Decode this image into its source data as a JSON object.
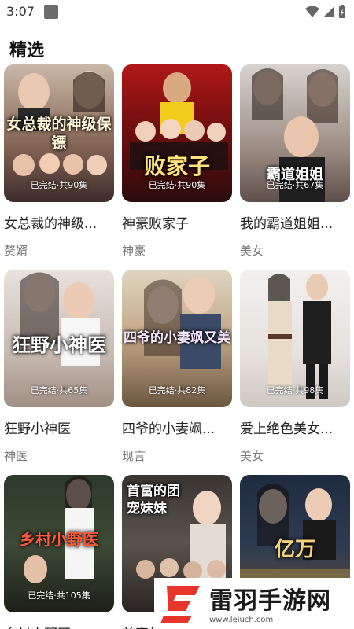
{
  "status_bar": {
    "time": "3:07"
  },
  "section": {
    "title": "精选"
  },
  "cards": [
    {
      "cover_text": "女总裁的神级保镖",
      "status": "已完结·共90集",
      "title": "女总裁的神级...",
      "tag": "赘婿"
    },
    {
      "cover_text": "败家子",
      "status": "已完结·共90集",
      "title": "神豪败家子",
      "tag": "神豪"
    },
    {
      "cover_text": "霸道姐姐",
      "status": "已完结·共67集",
      "title": "我的霸道姐姐...",
      "tag": "美女"
    },
    {
      "cover_text": "狂野小神医",
      "status": "已完结·共65集",
      "title": "狂野小神医",
      "tag": "神医"
    },
    {
      "cover_text": "四爷的小妻飒又美",
      "status": "已完结·共82集",
      "title": "四爷的小妻飒...",
      "tag": "现言"
    },
    {
      "cover_text": "",
      "status": "已完结·共98集",
      "title": "爱上绝色美女...",
      "tag": "美女"
    },
    {
      "cover_text": "乡村小野医",
      "status": "已完结·共105集",
      "title": "乡村小野医",
      "tag": ""
    },
    {
      "cover_text": "首富的团宠妹妹",
      "status": "",
      "title": "首富的...",
      "tag": ""
    },
    {
      "cover_text": "亿万",
      "status": "",
      "title": "",
      "tag": ""
    }
  ],
  "watermark": {
    "name": "雷羽手游网",
    "url": "www.leiuch.com"
  },
  "colors": {
    "accent_red": "#e8352b",
    "tag_gray": "#777777"
  }
}
